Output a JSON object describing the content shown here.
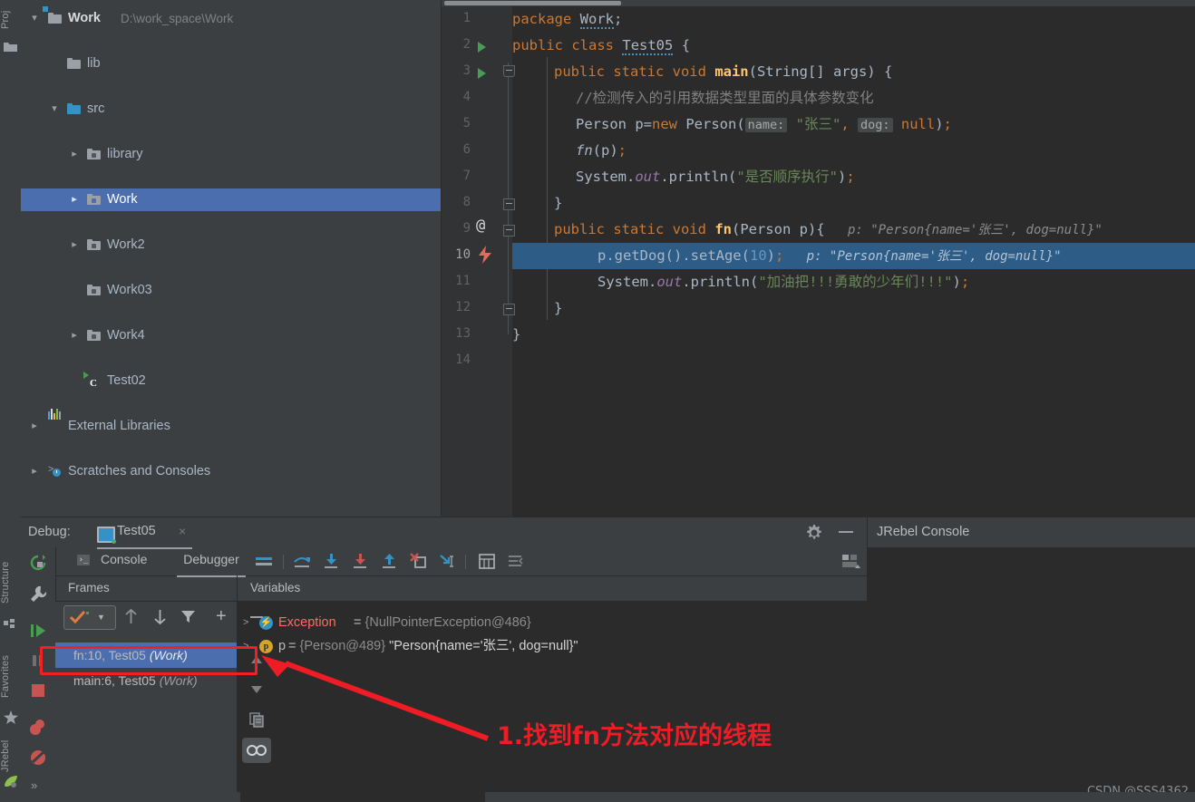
{
  "left_strip": {
    "top_tab": "Proj",
    "tabs": [
      {
        "label": "Structure",
        "icon": "structure-icon"
      },
      {
        "label": "Favorites",
        "icon": "star-icon"
      },
      {
        "label": "JRebel",
        "icon": "jrebel-leaf-icon"
      }
    ]
  },
  "project_tree": {
    "items": [
      {
        "label": "Work",
        "path": "D:\\work_space\\Work",
        "indent": 0,
        "arrow": "v",
        "icon": "module-folder-icon",
        "bold": true,
        "selected": false
      },
      {
        "label": "lib",
        "path": "",
        "indent": 1,
        "arrow": "",
        "icon": "folder-icon",
        "bold": false,
        "selected": false
      },
      {
        "label": "src",
        "path": "",
        "indent": 1,
        "arrow": "v",
        "icon": "source-folder-icon",
        "bold": false,
        "selected": false
      },
      {
        "label": "library",
        "path": "",
        "indent": 2,
        "arrow": ">",
        "icon": "package-icon",
        "bold": false,
        "selected": false
      },
      {
        "label": "Work",
        "path": "",
        "indent": 2,
        "arrow": ">",
        "icon": "package-icon",
        "bold": false,
        "selected": true
      },
      {
        "label": "Work2",
        "path": "",
        "indent": 2,
        "arrow": ">",
        "icon": "package-icon",
        "bold": false,
        "selected": false
      },
      {
        "label": "Work03",
        "path": "",
        "indent": 2,
        "arrow": "",
        "icon": "package-icon",
        "bold": false,
        "selected": false
      },
      {
        "label": "Work4",
        "path": "",
        "indent": 2,
        "arrow": ">",
        "icon": "package-icon",
        "bold": false,
        "selected": false
      },
      {
        "label": "Test02",
        "path": "",
        "indent": 2,
        "arrow": "",
        "icon": "java-class-runnable-icon",
        "bold": false,
        "selected": false
      },
      {
        "label": "External Libraries",
        "path": "",
        "indent": 0,
        "arrow": ">",
        "icon": "external-libraries-icon",
        "bold": false,
        "selected": false
      },
      {
        "label": "Scratches and Consoles",
        "path": "",
        "indent": 0,
        "arrow": ">",
        "icon": "scratches-icon",
        "bold": false,
        "selected": false
      }
    ]
  },
  "editor": {
    "lines": [
      {
        "n": "1",
        "gutter": "",
        "highlight": false
      },
      {
        "n": "2",
        "gutter": "run",
        "highlight": false
      },
      {
        "n": "3",
        "gutter": "run",
        "highlight": false
      },
      {
        "n": "4",
        "gutter": "",
        "highlight": false
      },
      {
        "n": "5",
        "gutter": "",
        "highlight": false
      },
      {
        "n": "6",
        "gutter": "",
        "highlight": false
      },
      {
        "n": "7",
        "gutter": "",
        "highlight": false
      },
      {
        "n": "8",
        "gutter": "",
        "highlight": false
      },
      {
        "n": "9",
        "gutter": "at",
        "highlight": false
      },
      {
        "n": "10",
        "gutter": "bolt",
        "highlight": true
      },
      {
        "n": "11",
        "gutter": "",
        "highlight": false
      },
      {
        "n": "12",
        "gutter": "",
        "highlight": false
      },
      {
        "n": "13",
        "gutter": "",
        "highlight": false
      },
      {
        "n": "14",
        "gutter": "",
        "highlight": false
      }
    ],
    "code": {
      "l1_package": "package",
      "l1_name": "Work",
      "l1_semi": ";",
      "l2_public": "public",
      "l2_class": "class",
      "l2_name": "Test05",
      "l2_brace": " {",
      "l3": "public static void main(String[] args) {",
      "l4_comment": "//检测传入的引用数据类型里面的具体参数变化",
      "l5_a": "Person p=",
      "l5_new": "new",
      "l5_b": " Person(",
      "l5_hint1": "name:",
      "l5_str": "\"张三\"",
      "l5_c": ", ",
      "l5_hint2": "dog:",
      "l5_null": "null",
      "l5_d": ");",
      "l6": "fn(p);",
      "l7_a": "System.",
      "l7_out": "out",
      "l7_b": ".println(",
      "l7_str": "\"是否顺序执行\"",
      "l7_c": ");",
      "l8": "}",
      "l9": "public static void fn(Person p){",
      "l9_hint": "p: \"Person{name='张三', dog=null}\"",
      "l10_a": "p.getDog().setAge(",
      "l10_num": "10",
      "l10_b": ");",
      "l10_hint": "p: \"Person{name='张三', dog=null}\"",
      "l11_a": "System.",
      "l11_out": "out",
      "l11_b": ".println(",
      "l11_str": "\"加油把!!!勇敢的少年们!!!\"",
      "l11_c": ");",
      "l12": "}",
      "l13": "}"
    }
  },
  "debug": {
    "label": "Debug:",
    "tab_name": "Test05",
    "tab_close": "×",
    "left_toolbar": [
      {
        "name": "rerun-icon"
      },
      {
        "name": "settings-wrench-icon"
      },
      {
        "name": "resume-program-icon"
      },
      {
        "name": "pause-program-icon"
      },
      {
        "name": "stop-icon"
      },
      {
        "name": "view-breakpoints-icon"
      },
      {
        "name": "mute-breakpoints-icon"
      },
      {
        "name": "more-icon"
      }
    ],
    "more_label": "»",
    "tabs": [
      {
        "label": "Console",
        "active": false,
        "icon": "console-icon"
      },
      {
        "label": "Debugger",
        "active": true,
        "icon": ""
      }
    ],
    "toolbar_icons": [
      {
        "name": "show-execution-point-icon"
      },
      {
        "name": "step-over-icon"
      },
      {
        "name": "step-into-icon"
      },
      {
        "name": "force-step-into-icon"
      },
      {
        "name": "step-out-icon"
      },
      {
        "name": "drop-frame-icon"
      },
      {
        "name": "run-to-cursor-icon"
      },
      {
        "name": "evaluate-expression-icon"
      },
      {
        "name": "layout-settings-icon"
      }
    ],
    "settings_icon": "gear-icon",
    "minimize_icon": "minimize-icon",
    "restore-layout-icon": "restore-layout-icon",
    "frames": {
      "header": "Frames",
      "thread_selector": "thread-combo",
      "toolbar": [
        {
          "name": "frame-up-icon"
        },
        {
          "name": "frame-down-icon"
        },
        {
          "name": "filter-icon"
        },
        {
          "name": "add-icon"
        }
      ],
      "rows": [
        {
          "label": "fn:10, Test05 ",
          "module": "(Work)",
          "selected": true
        },
        {
          "label": "main:6, Test05 ",
          "module": "(Work)",
          "selected": false
        }
      ]
    },
    "variables": {
      "header": "Variables",
      "rows": [
        {
          "chevron": ">",
          "icon_letter": "⚡",
          "icon_color": "#3592c4",
          "name": "Exception",
          "name_class": "vn-exc",
          "eq": " = ",
          "ref": "{NullPointerException@486}",
          "value": ""
        },
        {
          "chevron": ">",
          "icon_letter": "p",
          "icon_color": "#d6a428",
          "name": "p",
          "name_class": "vn-p",
          "eq": " = ",
          "ref": "{Person@489} ",
          "value": "\"Person{name='张三', dog=null}\""
        }
      ],
      "side_buttons": [
        {
          "name": "collapse-icon"
        },
        {
          "name": "move-up-icon"
        },
        {
          "name": "move-down-icon"
        },
        {
          "name": "copy-icon"
        },
        {
          "name": "watches-icon"
        }
      ]
    }
  },
  "jrebel": {
    "title": "JRebel Console"
  },
  "watermark": "CSDN @SSS4362",
  "annotations": {
    "text": "1.找到fn方法对应的线程",
    "color": "#ee1c25",
    "box_color": "#f41f1f"
  }
}
